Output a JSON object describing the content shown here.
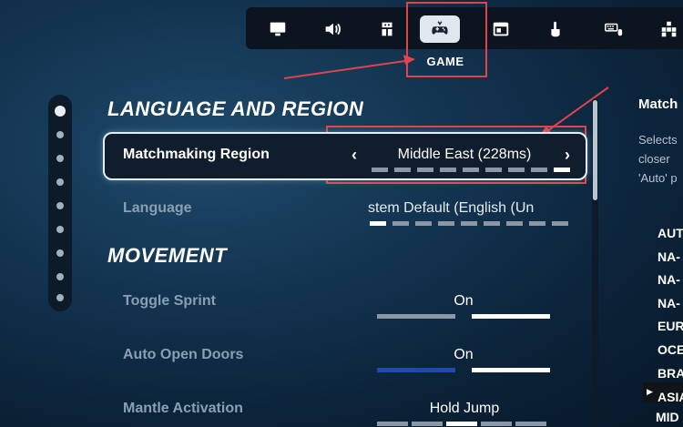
{
  "tabs": [
    {
      "name": "display",
      "icon": "monitor-icon"
    },
    {
      "name": "audio",
      "icon": "speaker-icon"
    },
    {
      "name": "accessibility",
      "icon": "puzzle-icon"
    },
    {
      "name": "game",
      "icon": "gamepad-icon",
      "active": true
    },
    {
      "name": "window",
      "icon": "window-icon"
    },
    {
      "name": "touch",
      "icon": "touch-icon"
    },
    {
      "name": "keyboard-mouse",
      "icon": "keyboard-mouse-icon"
    },
    {
      "name": "controller",
      "icon": "grid-icon"
    }
  ],
  "active_tab_label": "GAME",
  "sections": {
    "language_region": "LANGUAGE AND REGION",
    "movement": "MOVEMENT"
  },
  "settings": {
    "matchmaking_region": {
      "label": "Matchmaking Region",
      "value": "Middle East (228ms)",
      "segments": 9,
      "selected_segment": 9
    },
    "language": {
      "label": "Language",
      "value": "stem Default (English (Un"
    },
    "toggle_sprint": {
      "label": "Toggle Sprint",
      "value": "On"
    },
    "auto_open_doors": {
      "label": "Auto Open Doors",
      "value": "On"
    },
    "mantle_activation": {
      "label": "Mantle Activation",
      "value": "Hold Jump"
    }
  },
  "right_panel": {
    "title": "Match",
    "desc_lines": [
      "Selects",
      "closer ",
      "'Auto' p"
    ],
    "items": [
      "AUT",
      "NA-",
      "NA-",
      "NA-",
      "EUR",
      "OCE",
      "BRA",
      "ASIA",
      "MID"
    ]
  },
  "colors": {
    "annotation_red": "#e0434c",
    "toggle_blue": "#1f4aa8",
    "segment_gray": "#8b97a4"
  }
}
